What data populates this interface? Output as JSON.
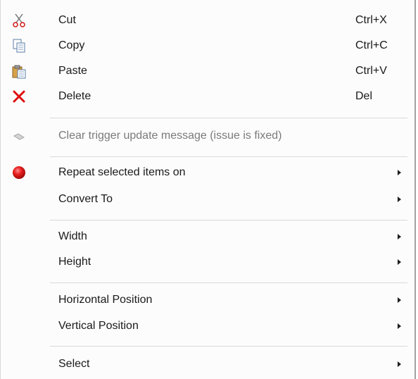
{
  "menu": {
    "cut": {
      "label": "Cut",
      "shortcut": "Ctrl+X",
      "icon": "scissors-icon"
    },
    "copy": {
      "label": "Copy",
      "shortcut": "Ctrl+C",
      "icon": "copy-icon"
    },
    "paste": {
      "label": "Paste",
      "shortcut": "Ctrl+V",
      "icon": "paste-icon"
    },
    "delete": {
      "label": "Delete",
      "shortcut": "Del",
      "icon": "delete-x-icon",
      "icon_color": "#e01010"
    },
    "clear_trigger": {
      "label": "Clear trigger update message (issue is fixed)",
      "disabled": true,
      "icon": "eraser-icon"
    },
    "repeat": {
      "label": "Repeat selected items on",
      "icon": "red-dot-icon",
      "icon_color": "#e01010"
    },
    "convert": {
      "label": "Convert To"
    },
    "width": {
      "label": "Width"
    },
    "height": {
      "label": "Height"
    },
    "hpos": {
      "label": "Horizontal Position"
    },
    "vpos": {
      "label": "Vertical Position"
    },
    "select": {
      "label": "Select"
    }
  }
}
